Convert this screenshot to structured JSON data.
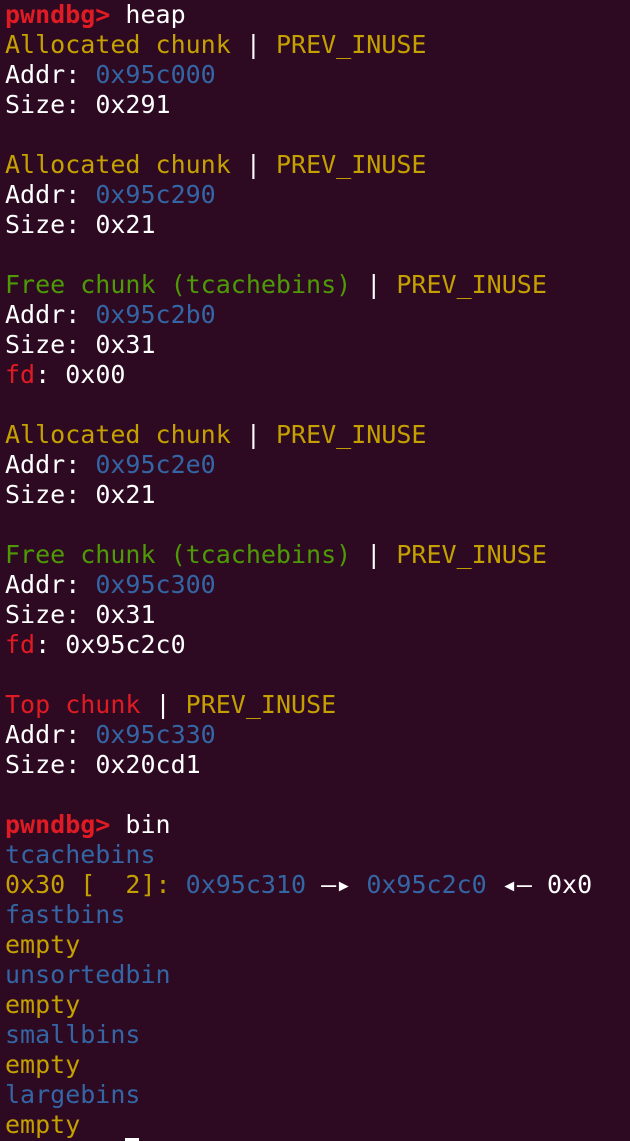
{
  "prompt": "pwndbg>",
  "commands": {
    "heap": "heap",
    "bin": "bin"
  },
  "chunks": [
    {
      "label": "Allocated chunk",
      "flags": "PREV_INUSE",
      "addr_label": "Addr:",
      "addr": "0x95c000",
      "size_label": "Size:",
      "size": "0x291"
    },
    {
      "label": "Allocated chunk",
      "flags": "PREV_INUSE",
      "addr_label": "Addr:",
      "addr": "0x95c290",
      "size_label": "Size:",
      "size": "0x21"
    },
    {
      "label": "Free chunk (tcachebins)",
      "flags": "PREV_INUSE",
      "addr_label": "Addr:",
      "addr": "0x95c2b0",
      "size_label": "Size:",
      "size": "0x31",
      "fd_label": "fd",
      "fd": "0x00"
    },
    {
      "label": "Allocated chunk",
      "flags": "PREV_INUSE",
      "addr_label": "Addr:",
      "addr": "0x95c2e0",
      "size_label": "Size:",
      "size": "0x21"
    },
    {
      "label": "Free chunk (tcachebins)",
      "flags": "PREV_INUSE",
      "addr_label": "Addr:",
      "addr": "0x95c300",
      "size_label": "Size:",
      "size": "0x31",
      "fd_label": "fd",
      "fd": "0x95c2c0"
    },
    {
      "label": "Top chunk",
      "flags": "PREV_INUSE",
      "addr_label": "Addr:",
      "addr": "0x95c330",
      "size_label": "Size:",
      "size": "0x20cd1"
    }
  ],
  "separator": "|",
  "bins": {
    "tcache_title": "tcachebins",
    "tcache_entry": {
      "size": "0x30",
      "count": "[  2]:",
      "first": "0x95c310",
      "arrow1": "—▸",
      "second": "0x95c2c0",
      "arrow2": "◂—",
      "end": "0x0"
    },
    "fastbins_title": "fastbins",
    "fastbins_value": "empty",
    "unsorted_title": "unsortedbin",
    "unsorted_value": "empty",
    "small_title": "smallbins",
    "small_value": "empty",
    "large_title": "largebins",
    "large_value": "empty"
  },
  "colors": {
    "background": "#2d0a22",
    "prompt": "#e01b24",
    "label_yellow": "#c4a000",
    "address_blue": "#3465a4",
    "free_green": "#4e9a06",
    "text": "#ffffff"
  }
}
